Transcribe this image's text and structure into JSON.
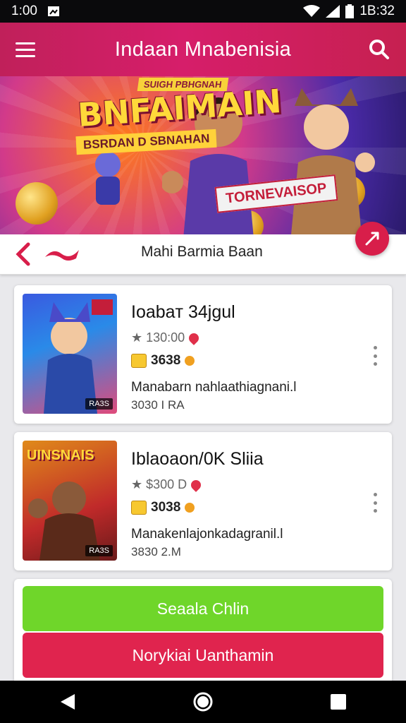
{
  "status": {
    "time": "1:00",
    "clock": "1B:32"
  },
  "header": {
    "title": "Indaan Mnabenisia"
  },
  "banner": {
    "small_text": "SUIGH PBHGNAH",
    "big_text": "BNFAIMAIN",
    "subline": "BSRDAN D SBNAHAN",
    "tag": "TORNEVAISOP"
  },
  "navrow": {
    "label": "Mahi Barmia Baan"
  },
  "cards": [
    {
      "title": "Ioabaт 34jgul",
      "rating": "★ 130:00",
      "price": "3638",
      "desc": "Manabarn nahlaathiagnani.l",
      "size": "3030 I RA",
      "thumb_tag": "RA3S"
    },
    {
      "title": "Iblaoaon/0K Sliia",
      "rating": "★ $300 D",
      "price": "3038",
      "desc": "Manakenlajonkadagranil.l",
      "size": "3830 2.M",
      "thumb_title": "UINSNAIS",
      "thumb_tag": "RA3S"
    }
  ],
  "buttons": {
    "primary": "Seaala Chlin",
    "secondary": "Norykiai Uanthamin"
  },
  "colors": {
    "accent": "#d61e6a",
    "green": "#6fd62a",
    "red": "#e0244e"
  },
  "icons": {
    "menu": "menu-icon",
    "search": "search-icon",
    "back": "chevron-left-icon",
    "more": "more-vertical-icon",
    "star": "star-icon"
  }
}
